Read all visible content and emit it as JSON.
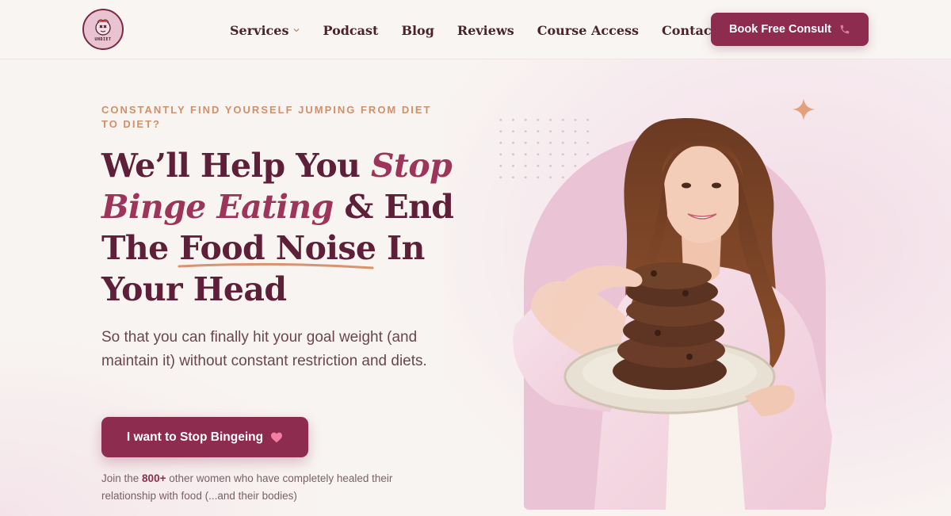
{
  "brand": {
    "logo_text": "UNDIET"
  },
  "nav": {
    "items": [
      {
        "label": "Services",
        "has_dropdown": true
      },
      {
        "label": "Podcast"
      },
      {
        "label": "Blog"
      },
      {
        "label": "Reviews"
      },
      {
        "label": "Course Access"
      },
      {
        "label": "Contact"
      }
    ],
    "cta_label": "Book Free Consult",
    "cta_icon": "phone-icon"
  },
  "hero": {
    "eyebrow": "Constantly find yourself jumping from diet to diet?",
    "headline": {
      "part1": "We’ll Help You ",
      "accent1": "Stop",
      "accent2": "Binge Eating",
      "part2": " & End",
      "part3": "The ",
      "underlined": "Food Noise",
      "part4": " In",
      "part5": "Your Head"
    },
    "subcopy": "So that you can finally hit your goal weight (and maintain it) without constant restriction and diets.",
    "cta_label": "I want to Stop Bingeing",
    "cta_icon": "heart-icon",
    "social_proof": {
      "prefix": "Join the ",
      "count": "800+",
      "suffix": " other women who have completely healed their relationship with food (...and their bodies)"
    }
  },
  "colors": {
    "brand": "#8d2c4e",
    "headline": "#5e1f38",
    "accent": "#9c3559",
    "eyebrow": "#d0906a",
    "arch": "#eac4d4",
    "background": "#f8f4f1"
  }
}
